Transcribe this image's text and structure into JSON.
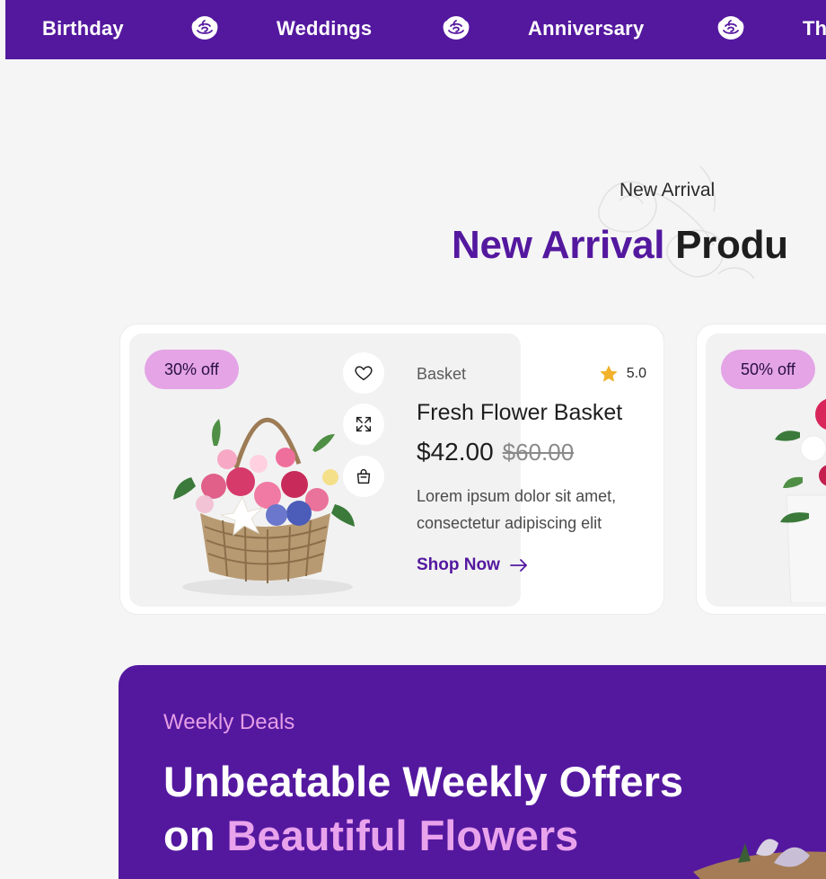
{
  "topbar": {
    "categories": [
      "Birthday",
      "Weddings",
      "Anniversary",
      "Th"
    ],
    "separator_icon": "rose-icon"
  },
  "section": {
    "eyebrow": "New Arrival",
    "title_accent": "New Arrival",
    "title_rest": "Produ"
  },
  "products": [
    {
      "badge": "30% off",
      "category": "Basket",
      "rating": "5.0",
      "name": "Fresh Flower Basket",
      "price": "$42.00",
      "old_price": "$60.00",
      "description": "Lorem ipsum dolor sit amet, consectetur adipiscing elit",
      "cta": "Shop Now"
    },
    {
      "badge": "50% off"
    }
  ],
  "deals": {
    "eyebrow": "Weekly Deals",
    "title_line1": "Unbeatable Weekly Offers",
    "title_line2_prefix": "on ",
    "title_line2_accent": "Beautiful Flowers"
  },
  "colors": {
    "brand": "#54189f",
    "badge": "#e4a4e6",
    "accent_pink": "#e9a3ec",
    "star": "#f2b22c",
    "background": "#f5f5f5"
  }
}
